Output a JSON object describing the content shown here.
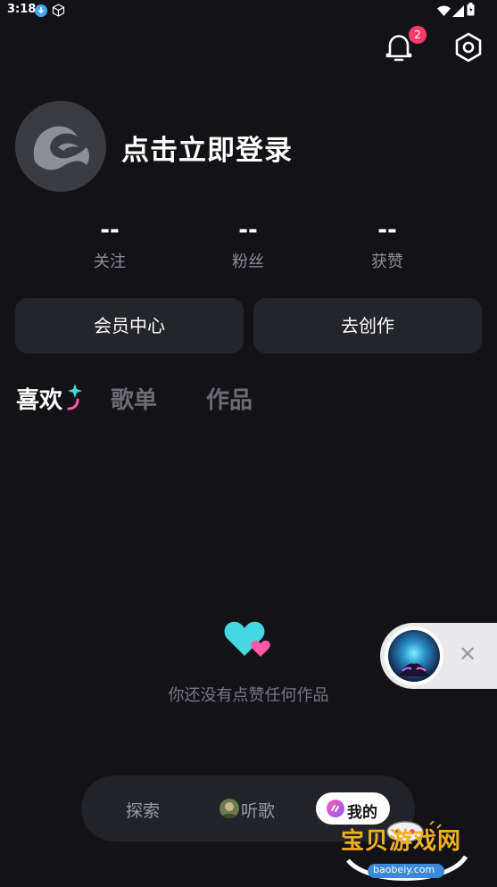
{
  "status_bar": {
    "time": "3:18"
  },
  "header": {
    "notification_count": "2"
  },
  "profile": {
    "login_text": "点击立即登录"
  },
  "stats": [
    {
      "value": "--",
      "label": "关注"
    },
    {
      "value": "--",
      "label": "粉丝"
    },
    {
      "value": "--",
      "label": "获赞"
    }
  ],
  "buttons": {
    "vip": "会员中心",
    "create": "去创作"
  },
  "tabs": [
    "喜欢",
    "歌单",
    "作品"
  ],
  "empty_state": {
    "text": "你还没有点赞任何作品"
  },
  "bottom_nav": {
    "explore": "探索",
    "listen": "听歌",
    "mine": "我的"
  },
  "watermark": {
    "title": "宝贝游戏网",
    "url": "baobeiy.com"
  },
  "colors": {
    "background": "#121217",
    "card": "#24252a",
    "accent_cyan": "#45d8e0",
    "accent_pink": "#ff5aa8",
    "badge": "#ff3b6a"
  }
}
